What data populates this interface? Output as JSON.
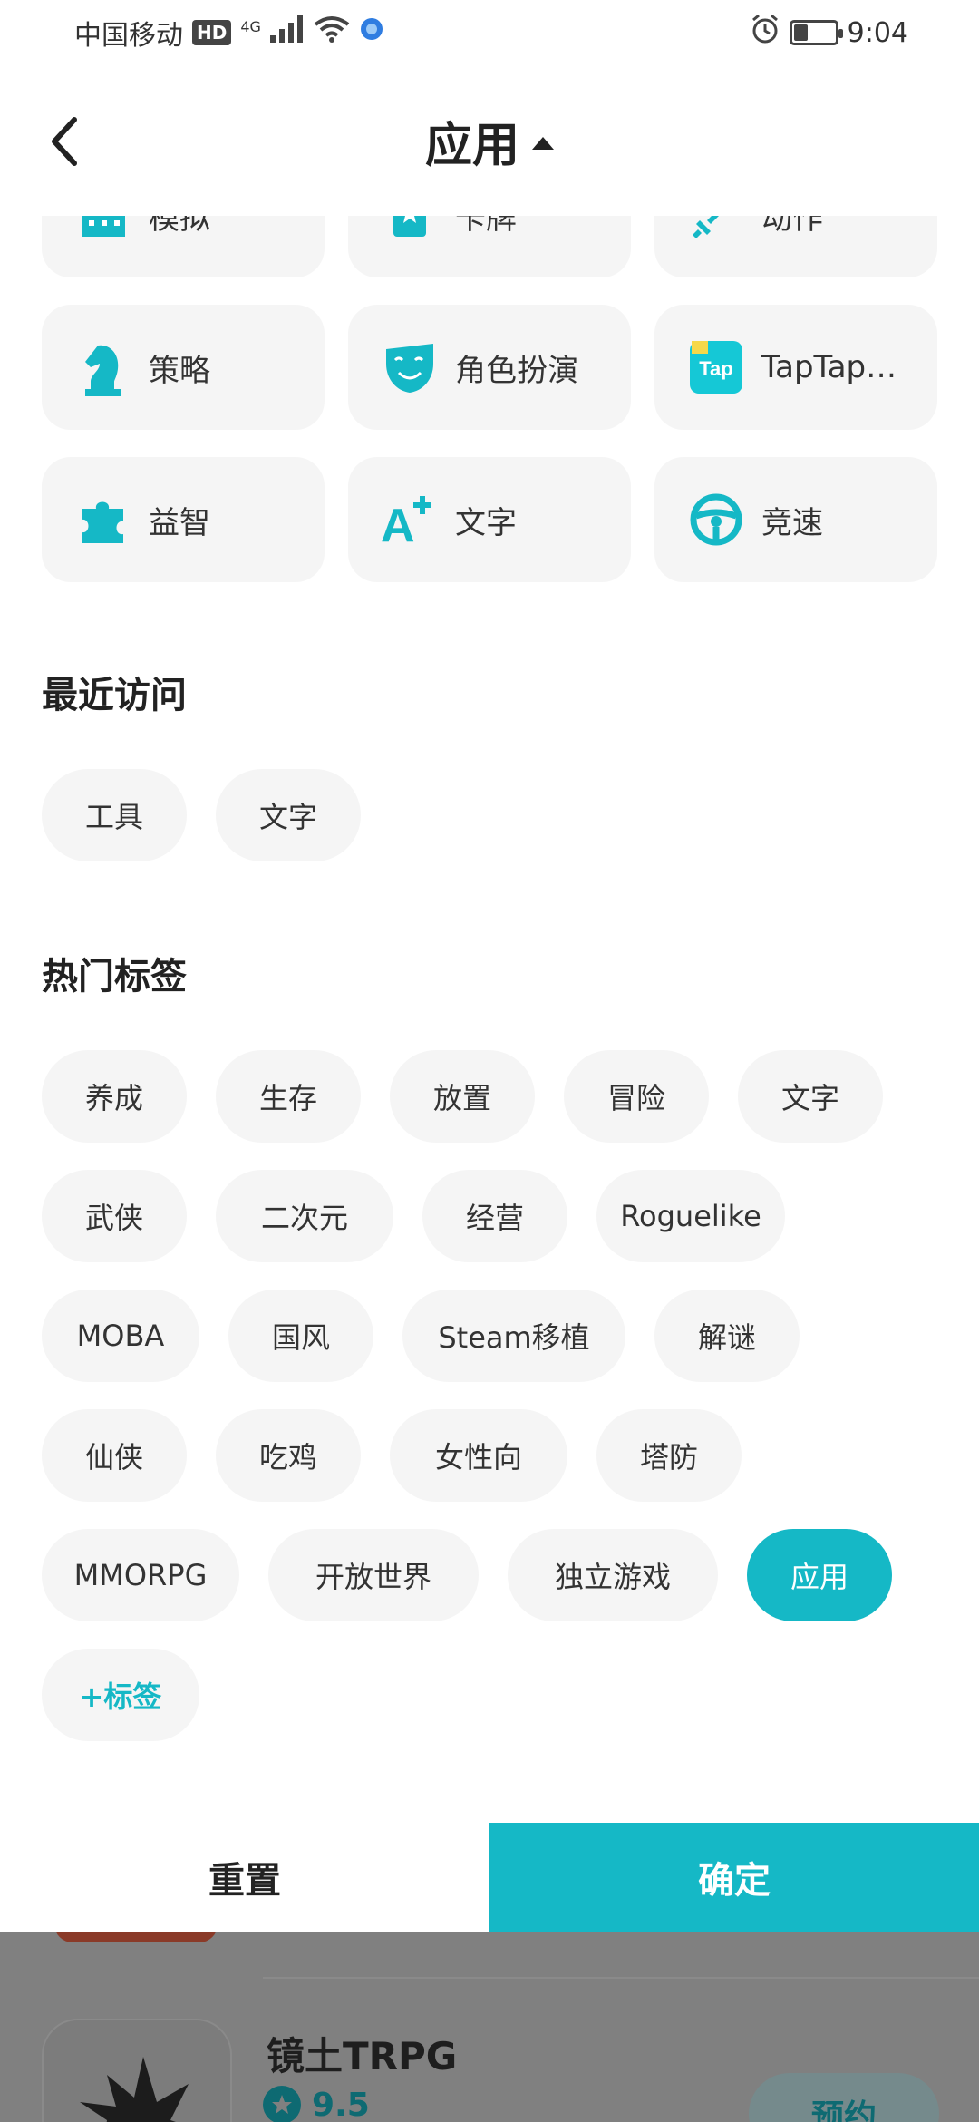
{
  "status_bar": {
    "carrier": "中国移动",
    "hd": "HD",
    "network": "4G",
    "time": "9:04",
    "battery_level": 0.35
  },
  "header": {
    "title": "应用",
    "back_icon": "chevron-left-icon",
    "toggle_icon": "caret-up-icon"
  },
  "categories": [
    {
      "label": "模拟",
      "icon": "building-icon"
    },
    {
      "label": "卡牌",
      "icon": "card-icon"
    },
    {
      "label": "动作",
      "icon": "sword-icon"
    },
    {
      "label": "策略",
      "icon": "chess-knight-icon"
    },
    {
      "label": "角色扮演",
      "icon": "mask-icon"
    },
    {
      "label": "TapTap…",
      "icon": "taptap-icon"
    },
    {
      "label": "益智",
      "icon": "puzzle-icon"
    },
    {
      "label": "文字",
      "icon": "text-plus-icon"
    },
    {
      "label": "竞速",
      "icon": "steering-wheel-icon"
    }
  ],
  "recent": {
    "title": "最近访问",
    "tags": [
      "工具",
      "文字"
    ]
  },
  "hot": {
    "title": "热门标签",
    "tags": [
      "养成",
      "生存",
      "放置",
      "冒险",
      "文字",
      "武侠",
      "二次元",
      "经营",
      "Roguelike",
      "MOBA",
      "国风",
      "Steam移植",
      "解谜",
      "仙侠",
      "吃鸡",
      "女性向",
      "塔防",
      "MMORPG",
      "开放世界",
      "独立游戏",
      "应用"
    ],
    "selected": "应用",
    "add_label": "+标签"
  },
  "actions": {
    "reset": "重置",
    "confirm": "确定"
  },
  "background_list": {
    "app_title": "镜土TRPG",
    "rating": "9.5",
    "button": "预约"
  },
  "colors": {
    "accent": "#15b8c6",
    "chip_bg": "#f5f5f5"
  }
}
